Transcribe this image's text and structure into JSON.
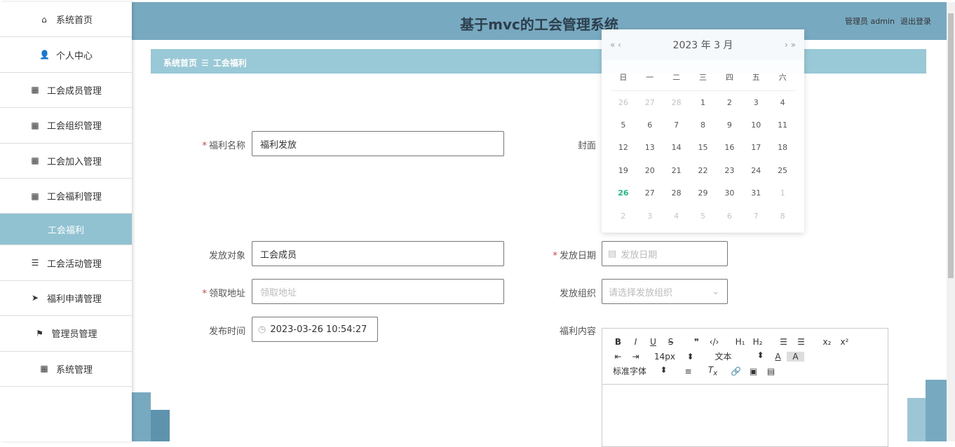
{
  "header": {
    "title": "基于mvc的工会管理系统",
    "user": "管理员 admin",
    "logout": "退出登录"
  },
  "sidebar": {
    "items": [
      {
        "label": "系统首页",
        "icon": "home-icon",
        "glyph": "⌂"
      },
      {
        "label": "个人中心",
        "icon": "user-icon",
        "glyph": "👤"
      },
      {
        "label": "工会成员管理",
        "icon": "grid-icon",
        "glyph": "▦"
      },
      {
        "label": "工会组织管理",
        "icon": "grid-icon",
        "glyph": "▦"
      },
      {
        "label": "工会加入管理",
        "icon": "grid-icon",
        "glyph": "▦"
      },
      {
        "label": "工会福利管理",
        "icon": "grid-icon",
        "glyph": "▦"
      },
      {
        "label": "工会福利",
        "icon": "",
        "glyph": ""
      },
      {
        "label": "工会活动管理",
        "icon": "list-icon",
        "glyph": "☰"
      },
      {
        "label": "福利申请管理",
        "icon": "send-icon",
        "glyph": "➤"
      },
      {
        "label": "管理员管理",
        "icon": "flag-icon",
        "glyph": "⚑"
      },
      {
        "label": "系统管理",
        "icon": "grid-icon",
        "glyph": "▦"
      }
    ]
  },
  "breadcrumb": {
    "home": "系统首页",
    "sep": "☰",
    "current": "工会福利"
  },
  "form": {
    "name_label": "福利名称",
    "name_value": "福利发放",
    "cover_label": "封面",
    "target_label": "发放对象",
    "target_value": "工会成员",
    "date_label": "发放日期",
    "date_placeholder": "发放日期",
    "address_label": "领取地址",
    "address_placeholder": "领取地址",
    "org_label": "发放组织",
    "org_placeholder": "请选择发放组织",
    "publish_label": "发布时间",
    "publish_value": "2023-03-26 10:54:27",
    "content_label": "福利内容"
  },
  "calendar": {
    "title": "2023 年  3 月",
    "prev": "« ‹",
    "next": "› »",
    "weekdays": [
      "日",
      "一",
      "二",
      "三",
      "四",
      "五",
      "六"
    ],
    "days": [
      [
        "26",
        "o"
      ],
      [
        "27",
        "o"
      ],
      [
        "28",
        "o"
      ],
      [
        "1",
        ""
      ],
      [
        "2",
        ""
      ],
      [
        "3",
        ""
      ],
      [
        "4",
        ""
      ],
      [
        "5",
        ""
      ],
      [
        "6",
        ""
      ],
      [
        "7",
        ""
      ],
      [
        "8",
        ""
      ],
      [
        "9",
        ""
      ],
      [
        "10",
        ""
      ],
      [
        "11",
        ""
      ],
      [
        "12",
        ""
      ],
      [
        "13",
        ""
      ],
      [
        "14",
        ""
      ],
      [
        "15",
        ""
      ],
      [
        "16",
        ""
      ],
      [
        "17",
        ""
      ],
      [
        "18",
        ""
      ],
      [
        "19",
        ""
      ],
      [
        "20",
        ""
      ],
      [
        "21",
        ""
      ],
      [
        "22",
        ""
      ],
      [
        "23",
        ""
      ],
      [
        "24",
        ""
      ],
      [
        "25",
        ""
      ],
      [
        "26",
        "t"
      ],
      [
        "27",
        ""
      ],
      [
        "28",
        ""
      ],
      [
        "29",
        ""
      ],
      [
        "30",
        ""
      ],
      [
        "31",
        ""
      ],
      [
        "1",
        "o"
      ],
      [
        "2",
        "o"
      ],
      [
        "3",
        "o"
      ],
      [
        "4",
        "o"
      ],
      [
        "5",
        "o"
      ],
      [
        "6",
        "o"
      ],
      [
        "7",
        "o"
      ],
      [
        "8",
        "o"
      ]
    ]
  },
  "editor": {
    "font_size": "14px",
    "block": "文本",
    "font": "标准字体"
  }
}
